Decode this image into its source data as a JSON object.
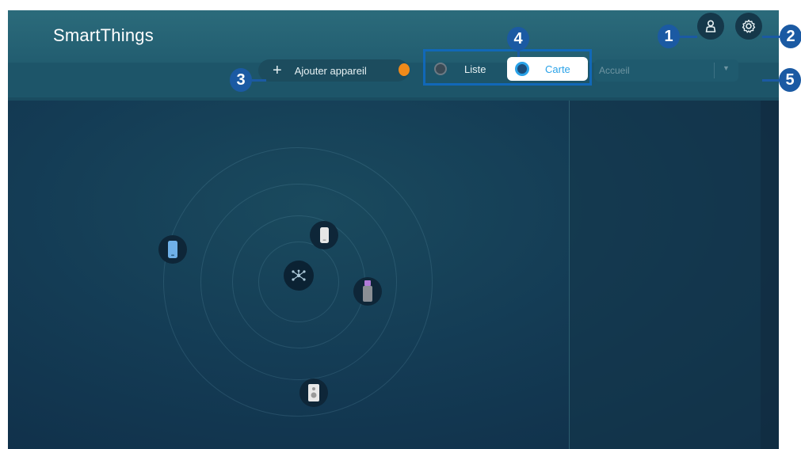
{
  "app": {
    "title": "SmartThings"
  },
  "header": {
    "profile_icon": "person-icon",
    "settings_icon": "gear-icon"
  },
  "toolbar": {
    "add_device_label": "Ajouter appareil",
    "add_icon": "plus-icon",
    "view_toggle": {
      "list_label": "Liste",
      "map_label": "Carte",
      "selected": "Carte"
    },
    "location_select": {
      "value": "Accueil"
    }
  },
  "map": {
    "hub_icon": "hub-icon",
    "devices": [
      {
        "name": "phone-device",
        "icon": "smartphone-icon"
      },
      {
        "name": "white-phone-device",
        "icon": "smartphone-icon"
      },
      {
        "name": "usb-device",
        "icon": "usb-stick-icon"
      },
      {
        "name": "speaker-device",
        "icon": "speaker-icon"
      }
    ]
  },
  "callouts": [
    "1",
    "2",
    "3",
    "4",
    "5"
  ],
  "colors": {
    "accent": "#2aa2e8",
    "callout": "#1b5aa3",
    "badge": "#f08a1a",
    "header": "#2b6b7b",
    "background": "#0f2d47"
  }
}
